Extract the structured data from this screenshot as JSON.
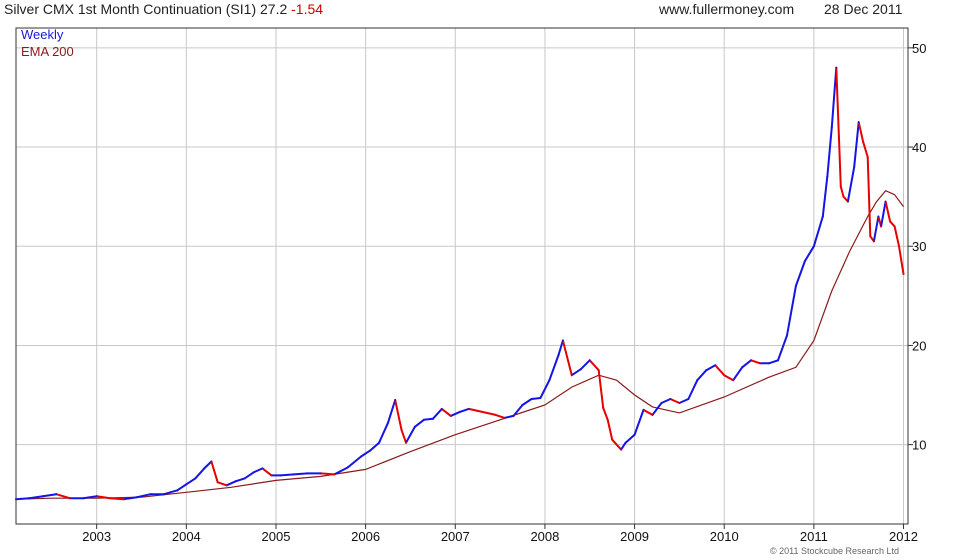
{
  "chart_data": {
    "type": "line",
    "title": "Silver CMX 1st Month Continuation (SI1)",
    "last_price": "27.2",
    "change": "-1.54",
    "source": "www.fullermoney.com",
    "date": "28 Dec 2011",
    "copyright": "© 2011 Stockcube Research Ltd",
    "x_ticks": [
      "2003",
      "2004",
      "2005",
      "2006",
      "2007",
      "2008",
      "2009",
      "2010",
      "2011",
      "2012"
    ],
    "y_ticks": [
      10,
      20,
      30,
      40,
      50
    ],
    "ylim": [
      2,
      52
    ],
    "xlim": [
      2002.1,
      2012.05
    ],
    "legend": [
      {
        "label": "Weekly",
        "color": "#1a1adb"
      },
      {
        "label": "EMA 200",
        "color": "#8b1a1a"
      }
    ],
    "colors": {
      "up": "#1414e6",
      "down": "#e60000",
      "ema": "#8b1a1a",
      "grid": "#c8c8c8"
    },
    "series": [
      {
        "name": "Weekly",
        "x": [
          2002.1,
          2002.25,
          2002.4,
          2002.55,
          2002.7,
          2002.85,
          2003.0,
          2003.15,
          2003.3,
          2003.45,
          2003.6,
          2003.75,
          2003.9,
          2004.0,
          2004.1,
          2004.2,
          2004.28,
          2004.35,
          2004.45,
          2004.55,
          2004.65,
          2004.75,
          2004.85,
          2004.95,
          2005.05,
          2005.2,
          2005.35,
          2005.5,
          2005.65,
          2005.8,
          2005.95,
          2006.05,
          2006.15,
          2006.25,
          2006.33,
          2006.4,
          2006.45,
          2006.55,
          2006.65,
          2006.75,
          2006.85,
          2006.95,
          2007.05,
          2007.15,
          2007.25,
          2007.35,
          2007.45,
          2007.55,
          2007.65,
          2007.75,
          2007.85,
          2007.95,
          2008.05,
          2008.15,
          2008.2,
          2008.3,
          2008.4,
          2008.5,
          2008.6,
          2008.65,
          2008.7,
          2008.75,
          2008.8,
          2008.85,
          2008.9,
          2009.0,
          2009.1,
          2009.2,
          2009.3,
          2009.4,
          2009.5,
          2009.6,
          2009.7,
          2009.8,
          2009.9,
          2010.0,
          2010.1,
          2010.2,
          2010.3,
          2010.4,
          2010.5,
          2010.6,
          2010.7,
          2010.8,
          2010.9,
          2011.0,
          2011.1,
          2011.15,
          2011.2,
          2011.25,
          2011.3,
          2011.33,
          2011.38,
          2011.45,
          2011.5,
          2011.55,
          2011.6,
          2011.63,
          2011.67,
          2011.72,
          2011.75,
          2011.8,
          2011.85,
          2011.9,
          2011.95,
          2012.0
        ],
        "values": [
          4.5,
          4.6,
          4.8,
          5.0,
          4.6,
          4.6,
          4.8,
          4.6,
          4.5,
          4.7,
          5.0,
          5.0,
          5.4,
          6.0,
          6.6,
          7.6,
          8.3,
          6.2,
          5.9,
          6.3,
          6.6,
          7.2,
          7.6,
          6.9,
          6.9,
          7.0,
          7.1,
          7.1,
          7.0,
          7.7,
          8.8,
          9.4,
          10.2,
          12.2,
          14.5,
          11.5,
          10.2,
          11.8,
          12.5,
          12.6,
          13.6,
          12.9,
          13.3,
          13.6,
          13.4,
          13.2,
          13.0,
          12.7,
          12.9,
          14.0,
          14.6,
          14.7,
          16.5,
          19.0,
          20.5,
          17.0,
          17.6,
          18.5,
          17.5,
          13.7,
          12.5,
          10.5,
          10.0,
          9.5,
          10.2,
          11.0,
          13.5,
          13.0,
          14.2,
          14.6,
          14.2,
          14.6,
          16.5,
          17.5,
          18.0,
          17.0,
          16.5,
          17.8,
          18.5,
          18.2,
          18.2,
          18.5,
          21.0,
          26.0,
          28.5,
          30.0,
          33.0,
          37.0,
          42.0,
          48.0,
          36.0,
          35.0,
          34.5,
          38.0,
          42.5,
          40.5,
          39.0,
          31.0,
          30.5,
          33.0,
          32.0,
          34.5,
          32.5,
          32.0,
          30.0,
          27.2
        ]
      },
      {
        "name": "EMA 200",
        "x": [
          2002.1,
          2002.5,
          2003.0,
          2003.5,
          2004.0,
          2004.5,
          2005.0,
          2005.5,
          2006.0,
          2006.5,
          2007.0,
          2007.5,
          2008.0,
          2008.3,
          2008.6,
          2008.8,
          2009.0,
          2009.2,
          2009.5,
          2010.0,
          2010.5,
          2010.8,
          2011.0,
          2011.2,
          2011.4,
          2011.6,
          2011.7,
          2011.8,
          2011.9,
          2012.0
        ],
        "values": [
          4.5,
          4.6,
          4.6,
          4.7,
          5.2,
          5.7,
          6.4,
          6.8,
          7.5,
          9.3,
          11.0,
          12.5,
          14.0,
          15.8,
          17.0,
          16.5,
          15.0,
          13.8,
          13.2,
          14.8,
          16.8,
          17.8,
          20.5,
          25.5,
          29.5,
          33.0,
          34.5,
          35.6,
          35.2,
          34.0
        ]
      }
    ]
  }
}
